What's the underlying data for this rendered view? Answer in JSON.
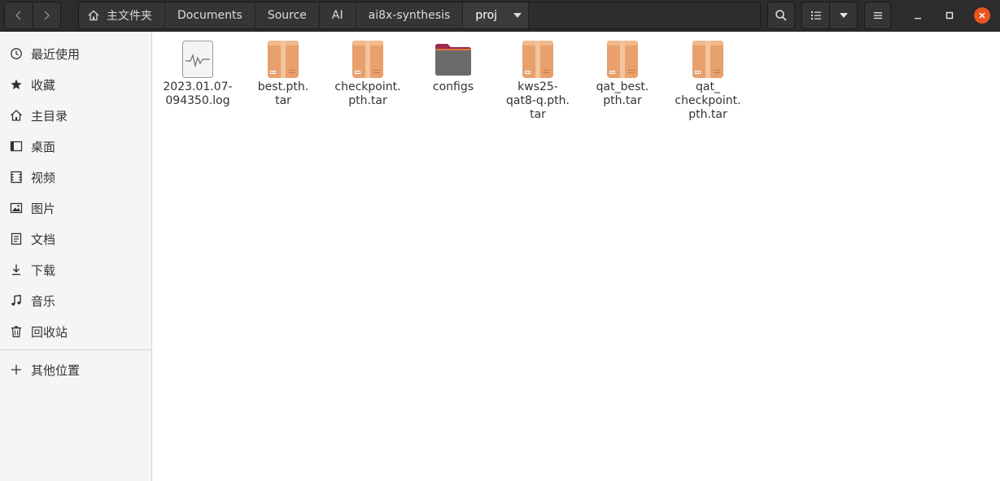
{
  "header": {
    "nav": {
      "back_icon": "chevron-left-icon",
      "forward_icon": "chevron-right-icon"
    },
    "pathbar": {
      "home_icon": "home-icon",
      "crumbs": [
        "主文件夹",
        "Documents",
        "Source",
        "AI",
        "ai8x-synthesis",
        "proj"
      ]
    },
    "buttons": {
      "search_icon": "search-icon",
      "list_view_icon": "list-view-icon",
      "view_options_icon": "caret-down-icon",
      "menu_icon": "hamburger-menu-icon",
      "minimize_icon": "minimize-icon",
      "maximize_icon": "maximize-icon",
      "close_icon": "close-icon"
    },
    "colors": {
      "close": "#e9541f",
      "bar": "#2c2c2c"
    }
  },
  "sidebar": {
    "items": [
      {
        "label": "最近使用",
        "icon": "clock-icon"
      },
      {
        "label": "收藏",
        "icon": "star-icon"
      },
      {
        "label": "主目录",
        "icon": "home-icon"
      },
      {
        "label": "桌面",
        "icon": "desktop-icon"
      },
      {
        "label": "视频",
        "icon": "video-icon"
      },
      {
        "label": "图片",
        "icon": "picture-icon"
      },
      {
        "label": "文档",
        "icon": "document-icon"
      },
      {
        "label": "下载",
        "icon": "download-icon"
      },
      {
        "label": "音乐",
        "icon": "music-icon"
      },
      {
        "label": "回收站",
        "icon": "trash-icon"
      }
    ],
    "other": {
      "label": "其他位置",
      "icon": "plus-icon"
    }
  },
  "files": [
    {
      "name": "2023.01.07-\n094350.log",
      "type": "log"
    },
    {
      "name": "best.pth.\ntar",
      "type": "archive"
    },
    {
      "name": "checkpoint.\npth.tar",
      "type": "archive"
    },
    {
      "name": "configs",
      "type": "folder"
    },
    {
      "name": "kws25-\nqat8-q.pth.\ntar",
      "type": "archive"
    },
    {
      "name": "qat_best.\npth.tar",
      "type": "archive"
    },
    {
      "name": "qat_\ncheckpoint.\npth.tar",
      "type": "archive"
    }
  ]
}
